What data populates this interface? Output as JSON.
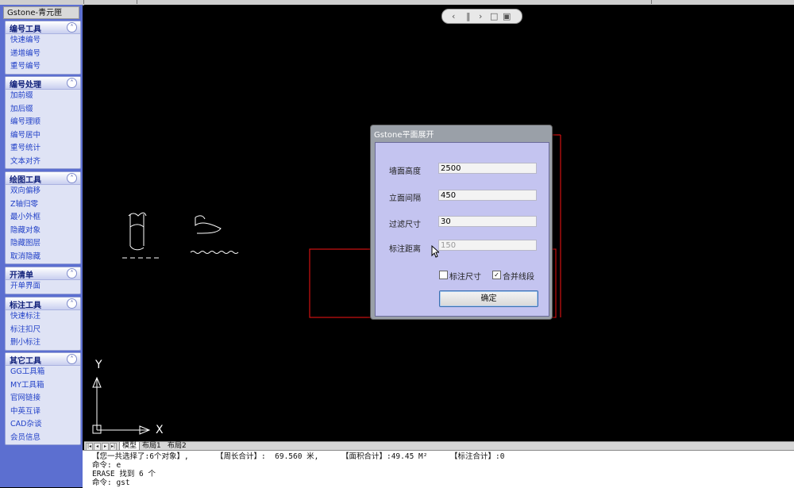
{
  "palette": {
    "title": "Gstone-青元匣",
    "groups": [
      {
        "title": "编号工具",
        "items": [
          "快速编号",
          "递增编号",
          "重号编号"
        ]
      },
      {
        "title": "编号处理",
        "items": [
          "加前缀",
          "加后缀",
          "编号理顺",
          "编号居中",
          "重号统计",
          "文本对齐"
        ]
      },
      {
        "title": "绘图工具",
        "items": [
          "双向偏移",
          "Z轴归零",
          "最小外框",
          "隐藏对象",
          "隐藏图层",
          "取消隐藏"
        ]
      },
      {
        "title": "开清单",
        "items": [
          "开单界面"
        ]
      },
      {
        "title": "标注工具",
        "items": [
          "快速标注",
          "标注扣尺",
          "删小标注"
        ]
      },
      {
        "title": "其它工具",
        "items": [
          "GG工具箱",
          "MY工具箱",
          "官网链接",
          "中英互译",
          "CAD杂谈",
          "会员信息"
        ]
      }
    ]
  },
  "navbar": {
    "icons": [
      "prev-icon",
      "pause-icon",
      "next-icon",
      "restore-icon",
      "maximize-icon"
    ]
  },
  "dialog": {
    "title": "Gstone平面展开",
    "fields": [
      {
        "label": "墙面高度",
        "value": "2500",
        "enabled": true
      },
      {
        "label": "立面间隔",
        "value": "450",
        "enabled": true
      },
      {
        "label": "过滤尺寸",
        "value": "30",
        "enabled": true
      },
      {
        "label": "标注距离",
        "value": "150",
        "enabled": false
      }
    ],
    "checkboxes": [
      {
        "label": "标注尺寸",
        "checked": false
      },
      {
        "label": "合并线段",
        "checked": true
      }
    ],
    "ok_label": "确定"
  },
  "ucs": {
    "x_label": "X",
    "y_label": "Y"
  },
  "tabs": {
    "items": [
      "模型",
      "布局1",
      "布局2"
    ],
    "active": 0
  },
  "command": {
    "lines": [
      "【您一共选择了:6个对象】,      【周长合计】:  69.560 米,     【面积合计】:49.45 M²     【标注合计】:0",
      "命令: e",
      "ERASE 找到 6 个",
      "命令: gst"
    ]
  }
}
